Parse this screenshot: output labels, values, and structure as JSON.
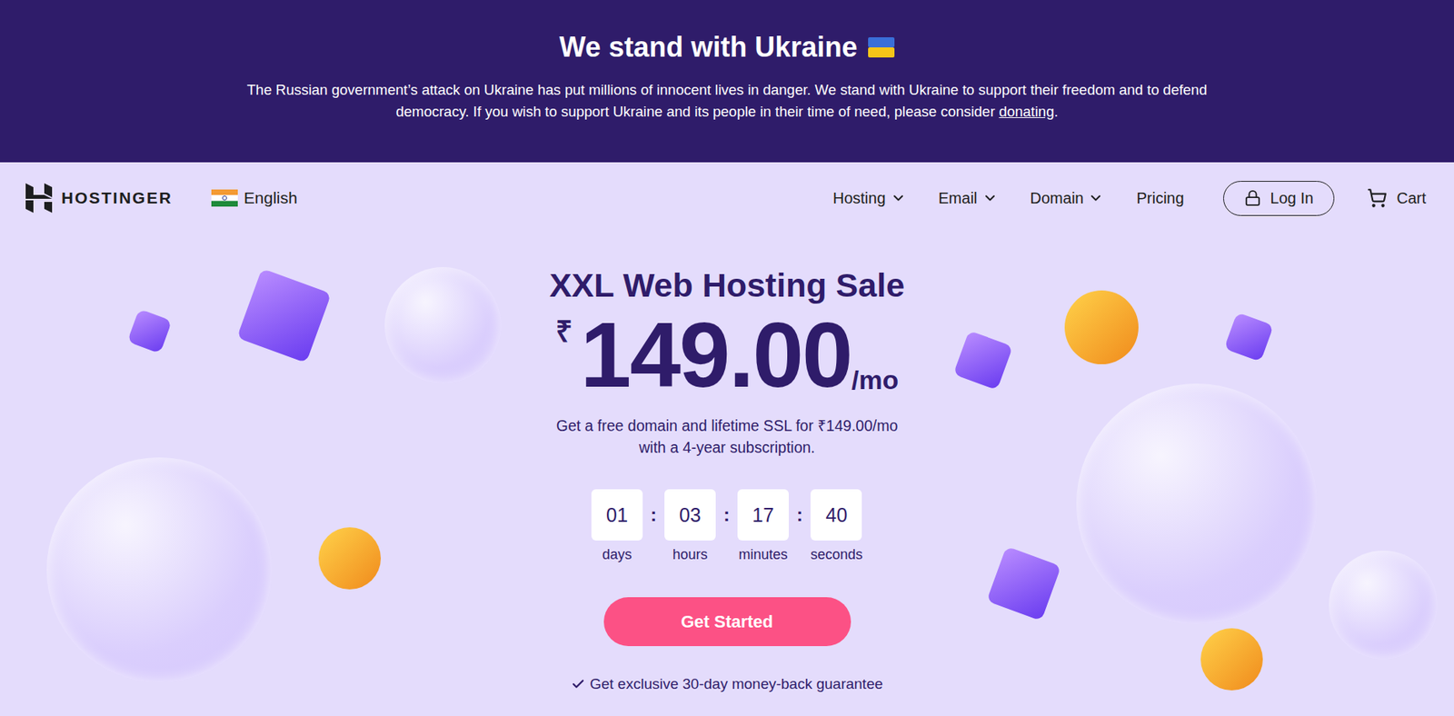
{
  "banner": {
    "title": "We stand with Ukraine",
    "lines": [
      "The Russian government’s attack on Ukraine has put millions of innocent lives in danger. We stand with Ukraine to support their freedom and to defend",
      "democracy. If you wish to support Ukraine and its people in their time of need, please consider "
    ],
    "link": "donating",
    "after": "."
  },
  "nav": {
    "brand": "HOSTINGER",
    "language": "English",
    "items": [
      {
        "label": "Hosting",
        "dropdown": true
      },
      {
        "label": "Email",
        "dropdown": true
      },
      {
        "label": "Domain",
        "dropdown": true
      },
      {
        "label": "Pricing",
        "dropdown": false
      }
    ],
    "login": "Log In",
    "cart": "Cart"
  },
  "hero": {
    "title": "XXL Web Hosting Sale",
    "currency": "₹",
    "price": "149.00",
    "period": "/mo",
    "subtitle": [
      "Get a free domain and lifetime SSL for ₹149.00/mo",
      "with a 4-year subscription."
    ],
    "countdown": [
      {
        "value": "01",
        "unit": "days"
      },
      {
        "value": "03",
        "unit": "hours"
      },
      {
        "value": "17",
        "unit": "minutes"
      },
      {
        "value": "40",
        "unit": "seconds"
      }
    ],
    "separator": ":",
    "cta": "Get Started",
    "guarantee": "Get exclusive 30-day money-back guarantee"
  }
}
